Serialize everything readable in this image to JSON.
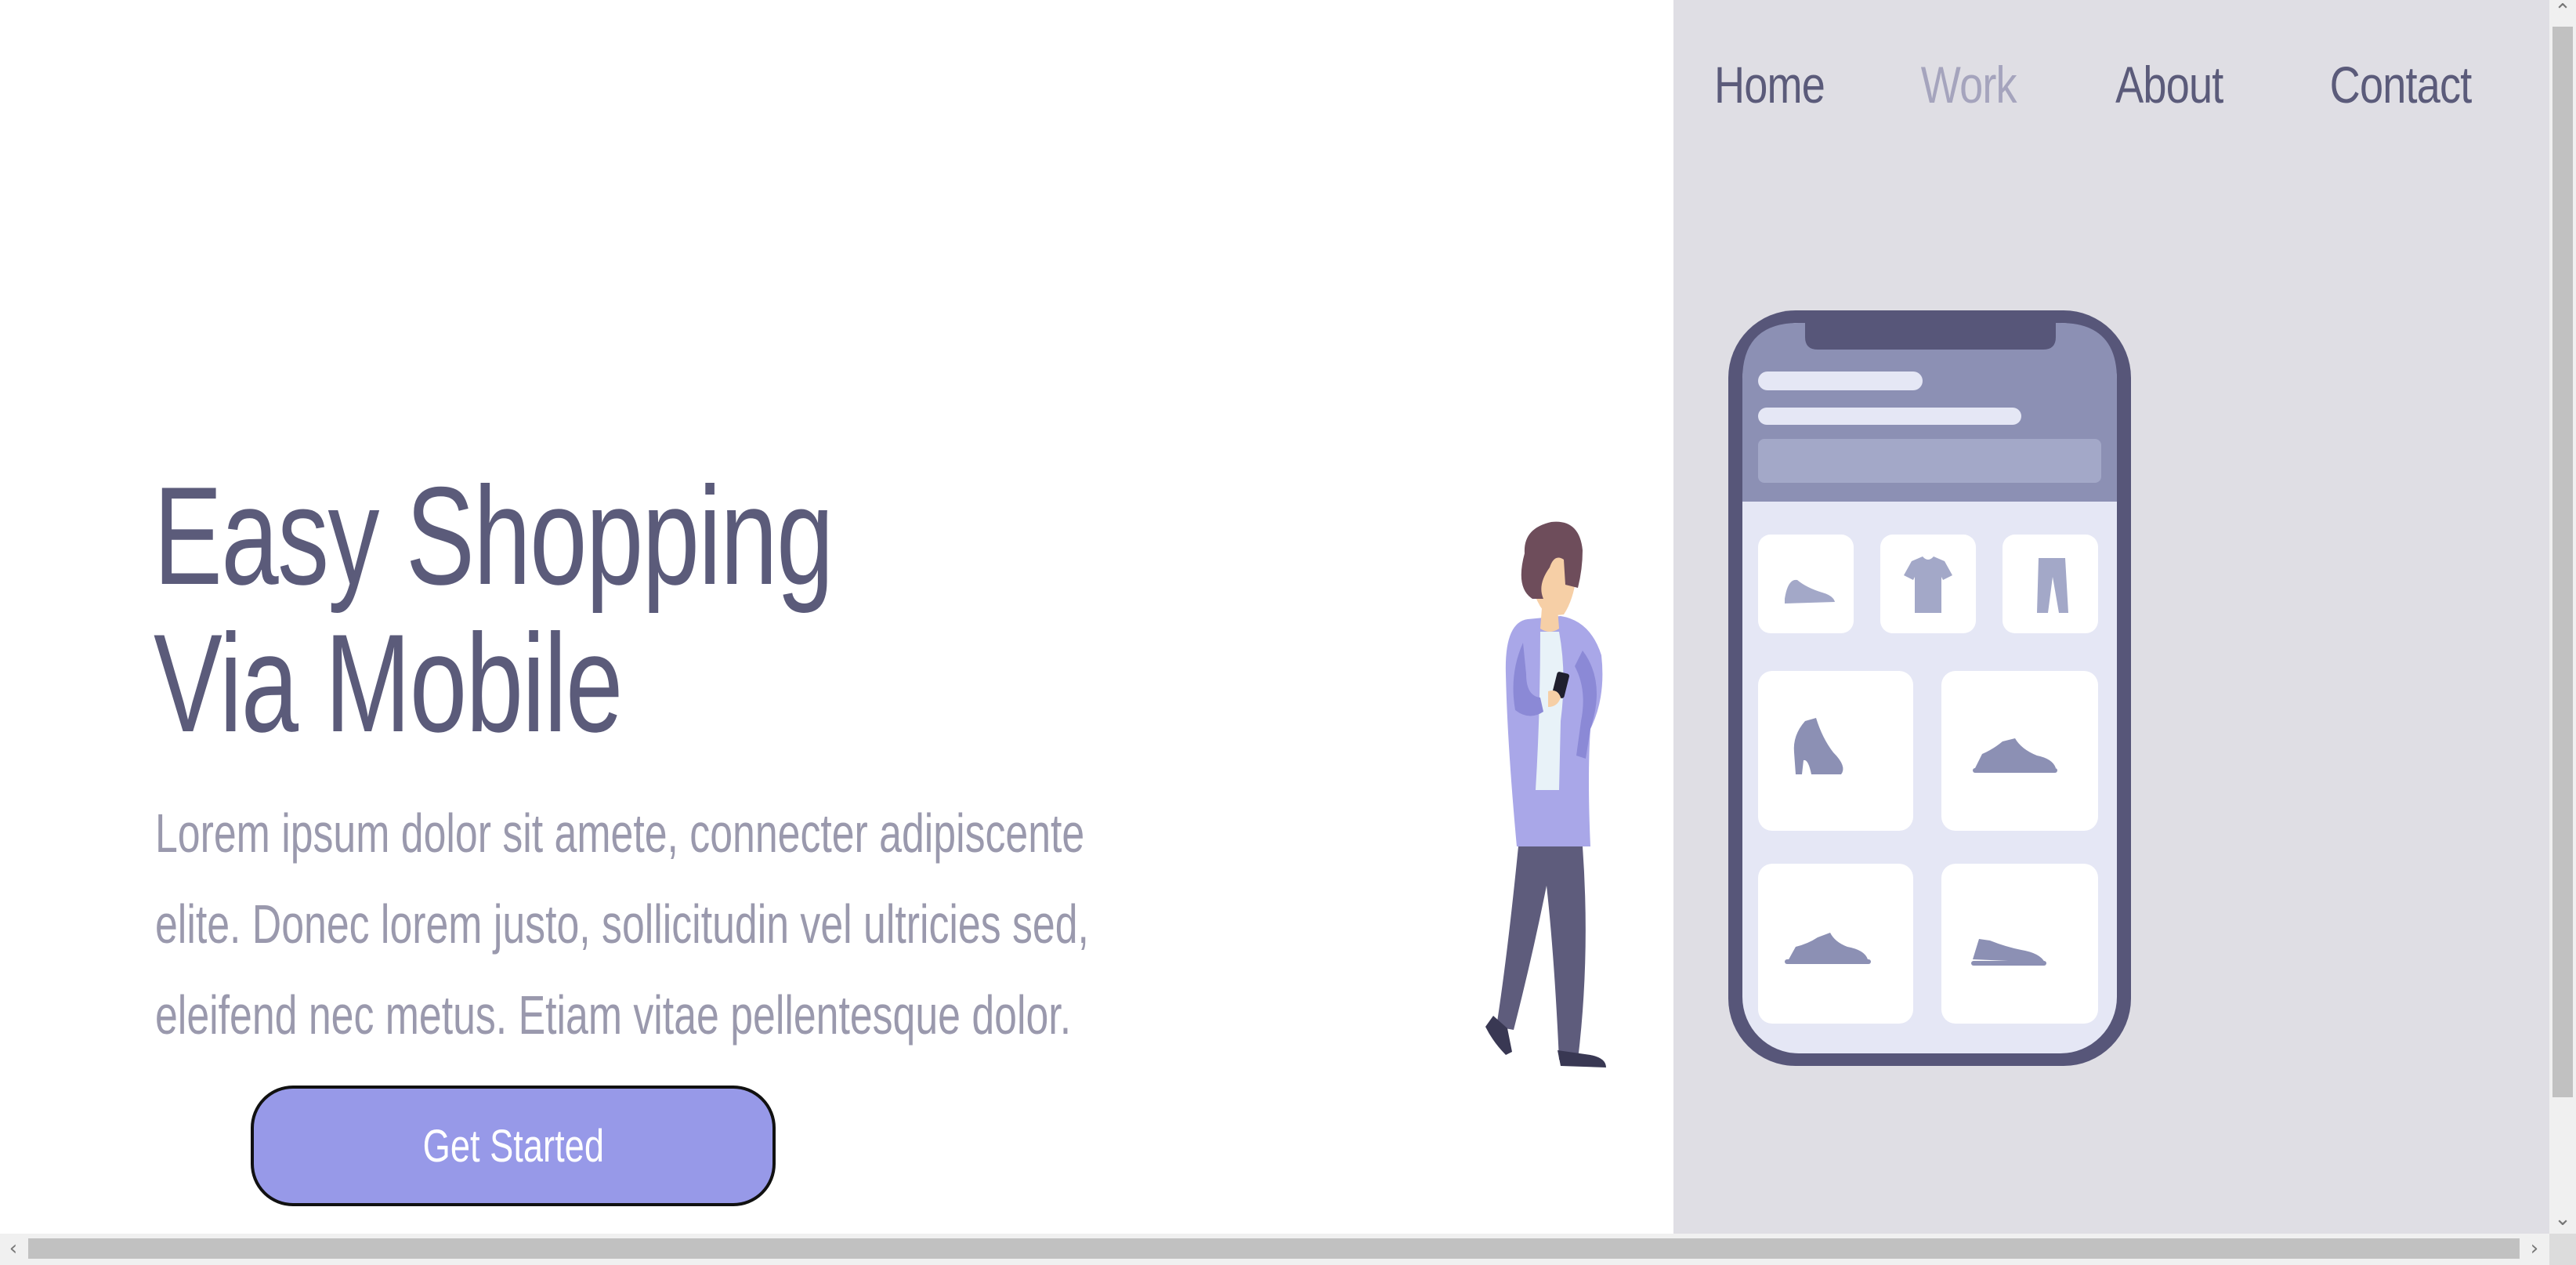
{
  "nav": {
    "items": [
      {
        "label": "Home",
        "active": false
      },
      {
        "label": "Work",
        "active": true
      },
      {
        "label": "About",
        "active": false
      },
      {
        "label": "Contact",
        "active": false
      }
    ]
  },
  "hero": {
    "title_line1": "Easy Shopping",
    "title_line2": "Via Mobile",
    "text_line1": "Lorem ipsum dolor sit amete, connecter adipiscente",
    "text_line2": "elite. Donec lorem justo, sollicitudin vel ultricies sed,",
    "text_line3": "eleifend nec metus. Etiam vitae pellentesque dolor.",
    "cta_label": "Get Started"
  },
  "illustration": {
    "subject": "woman-holding-phone-next-to-shopping-app",
    "product_icons": [
      "shoe-icon",
      "tshirt-icon",
      "pants-icon",
      "boot-icon",
      "sneaker-icon",
      "sneaker-icon",
      "sneaker-icon"
    ]
  },
  "colors": {
    "text_primary": "#5b5b7a",
    "text_muted": "#9a99ad",
    "nav_active": "#a5a4bd",
    "panel_bg": "#dfdee4",
    "button_bg": "#9799e8",
    "phone_frame": "#575679",
    "phone_header": "#8c90b4",
    "phone_screen": "#e5e7f5"
  }
}
